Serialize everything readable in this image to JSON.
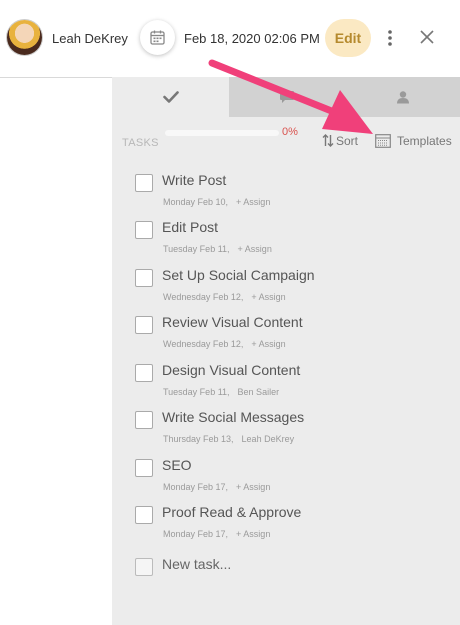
{
  "header": {
    "user_name": "Leah DeKrey",
    "date": "Feb 18, 2020 02:06 PM",
    "edit_label": "Edit"
  },
  "tabs": [
    {
      "icon": "checkmark-icon"
    },
    {
      "icon": "comment-icon"
    },
    {
      "icon": "user-icon"
    }
  ],
  "tasks_header": {
    "label": "TASKS",
    "progress": "0%",
    "progress_value": 0,
    "sort_label": "Sort",
    "templates_label": "Templates"
  },
  "tasks": [
    {
      "title": "Write Post",
      "date": "Monday Feb 10,",
      "assignee": "+ Assign"
    },
    {
      "title": "Edit Post",
      "date": "Tuesday Feb 11,",
      "assignee": "+ Assign"
    },
    {
      "title": "Set Up Social Campaign",
      "date": "Wednesday Feb 12,",
      "assignee": "+ Assign"
    },
    {
      "title": "Review Visual Content",
      "date": "Wednesday Feb 12,",
      "assignee": "+ Assign"
    },
    {
      "title": "Design Visual Content",
      "date": "Tuesday Feb 11,",
      "assignee": "Ben Sailer"
    },
    {
      "title": "Write Social Messages",
      "date": "Thursday Feb 13,",
      "assignee": "Leah DeKrey"
    },
    {
      "title": "SEO",
      "date": "Monday Feb 17,",
      "assignee": "+ Assign"
    },
    {
      "title": "Proof Read & Approve",
      "date": "Monday Feb 17,",
      "assignee": "+ Assign"
    }
  ],
  "new_task": {
    "placeholder": "New task..."
  },
  "colors": {
    "accent_edit_bg": "#fbe9c3",
    "accent_edit_text": "#b58a2e",
    "progress_text": "#d9534f",
    "annotation_arrow": "#f0407a"
  }
}
